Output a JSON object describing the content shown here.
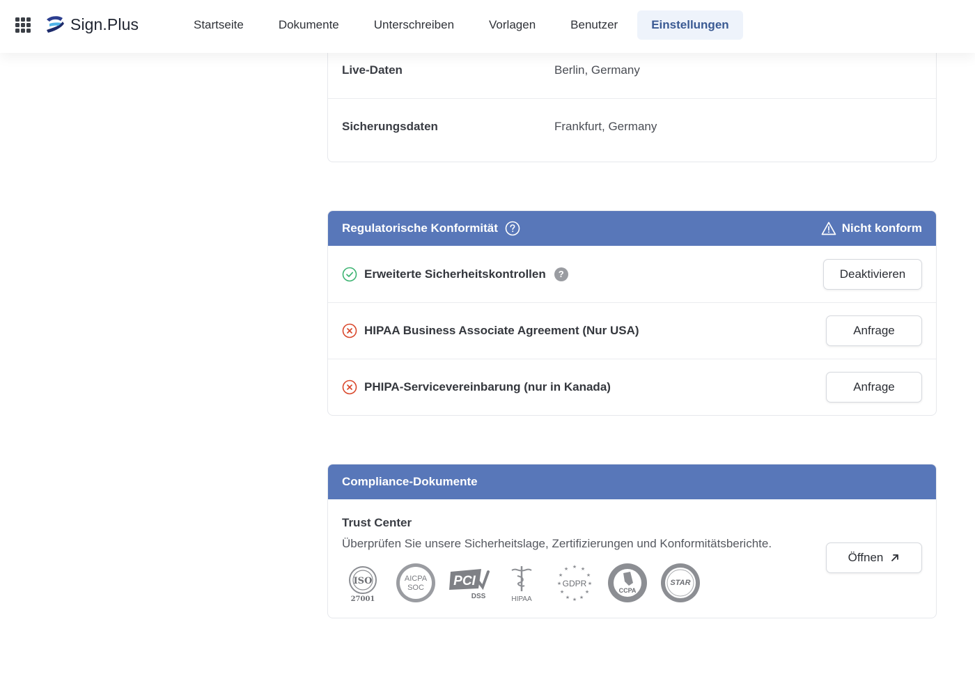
{
  "brand": {
    "name": "Sign.Plus"
  },
  "nav": {
    "items": [
      "Startseite",
      "Dokumente",
      "Unterschreiben",
      "Vorlagen",
      "Benutzer",
      "Einstellungen"
    ],
    "active": "Einstellungen"
  },
  "locations": {
    "rows": [
      {
        "label": "Live-Daten",
        "value": "Berlin, Germany"
      },
      {
        "label": "Sicherungsdaten",
        "value": "Frankfurt, Germany"
      }
    ]
  },
  "regulatory": {
    "title": "Regulatorische Konformität",
    "status": "Nicht konform",
    "items": [
      {
        "label": "Erweiterte Sicherheitskontrollen",
        "state": "enabled",
        "help": "?",
        "action": "Deaktivieren"
      },
      {
        "label": "HIPAA Business Associate Agreement (Nur USA)",
        "state": "disabled",
        "action": "Anfrage"
      },
      {
        "label": "PHIPA-Servicevereinbarung (nur in Kanada)",
        "state": "disabled",
        "action": "Anfrage"
      }
    ]
  },
  "compliance_docs": {
    "title": "Compliance-Dokumente",
    "trust_center": {
      "title": "Trust Center",
      "description": "Überprüfen Sie unsere Sicherheitslage, Zertifizierungen und Konformitätsberichte.",
      "action": "Öffnen",
      "badges": [
        {
          "name": "iso-27001-badge",
          "text": "ISO",
          "sub": "27001"
        },
        {
          "name": "aicpa-soc-badge",
          "text": "AICPA",
          "sub": "SOC"
        },
        {
          "name": "pci-dss-badge",
          "text": "PCI",
          "sub": "DSS"
        },
        {
          "name": "hipaa-badge",
          "text": "HIPAA"
        },
        {
          "name": "gdpr-badge",
          "text": "GDPR"
        },
        {
          "name": "ccpa-badge",
          "text": "CCPA"
        },
        {
          "name": "star-badge",
          "text": "STAR"
        }
      ]
    }
  },
  "colors": {
    "header_blue": "#5877b9",
    "active_nav_bg": "#eef3fb",
    "success": "#3cb371",
    "error": "#d9472b"
  }
}
